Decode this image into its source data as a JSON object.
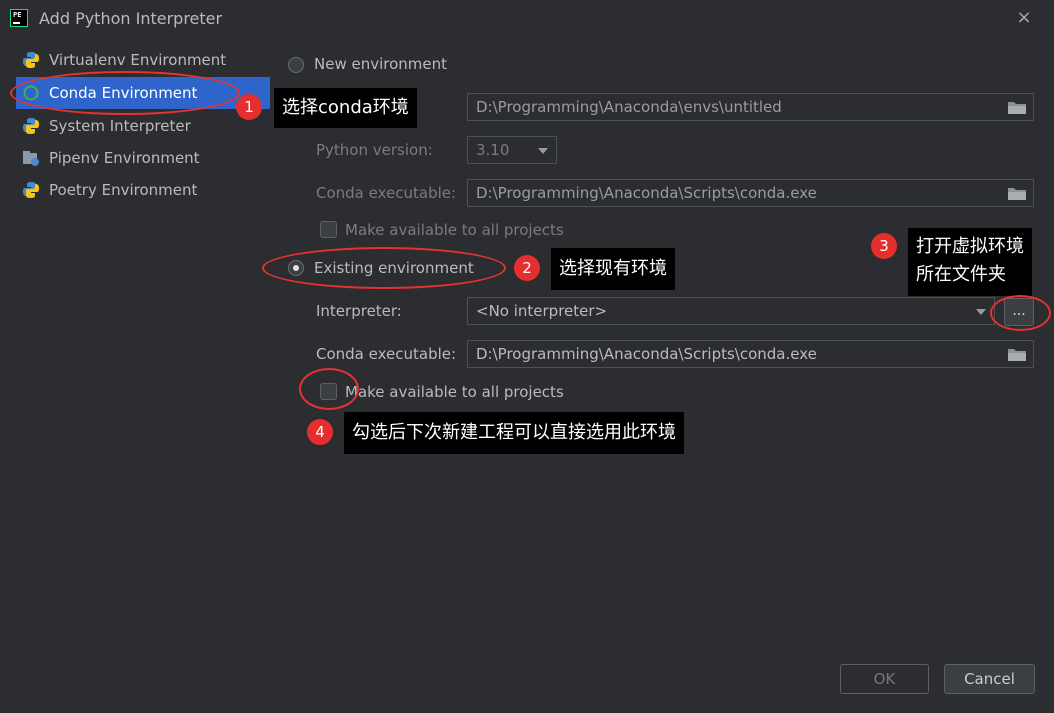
{
  "window": {
    "title": "Add Python Interpreter",
    "close_icon": "×"
  },
  "sidebar": {
    "items": [
      {
        "label": "Virtualenv Environment",
        "icon": "python-icon"
      },
      {
        "label": "Conda Environment",
        "icon": "conda-icon",
        "selected": true
      },
      {
        "label": "System Interpreter",
        "icon": "python-icon"
      },
      {
        "label": "Pipenv Environment",
        "icon": "pipenv-icon"
      },
      {
        "label": "Poetry Environment",
        "icon": "poetry-icon"
      }
    ]
  },
  "new_env": {
    "radio_label": "New environment",
    "location_value": "D:\\Programming\\Anaconda\\envs\\untitled",
    "python_version_label": "Python version:",
    "python_version_value": "3.10",
    "conda_exe_label": "Conda executable:",
    "conda_exe_value": "D:\\Programming\\Anaconda\\Scripts\\conda.exe",
    "make_available_label": "Make available to all projects"
  },
  "existing_env": {
    "radio_label": "Existing environment",
    "interpreter_label": "Interpreter:",
    "interpreter_value": "<No interpreter>",
    "browse_label": "...",
    "conda_exe_label": "Conda executable:",
    "conda_exe_value": "D:\\Programming\\Anaconda\\Scripts\\conda.exe",
    "make_available_label": "Make available to all projects"
  },
  "annotations": [
    {
      "number": "1",
      "text": "选择conda环境"
    },
    {
      "number": "2",
      "text": "选择现有环境"
    },
    {
      "number": "3",
      "line1": "打开虚拟环境",
      "line2": "所在文件夹"
    },
    {
      "number": "4",
      "text": "勾选后下次新建工程可以直接选用此环境"
    }
  ],
  "buttons": {
    "ok": "OK",
    "cancel": "Cancel"
  },
  "colors": {
    "accent": "#2f65ca",
    "annotation_red": "#e62e2e",
    "background": "#2b2d30"
  }
}
